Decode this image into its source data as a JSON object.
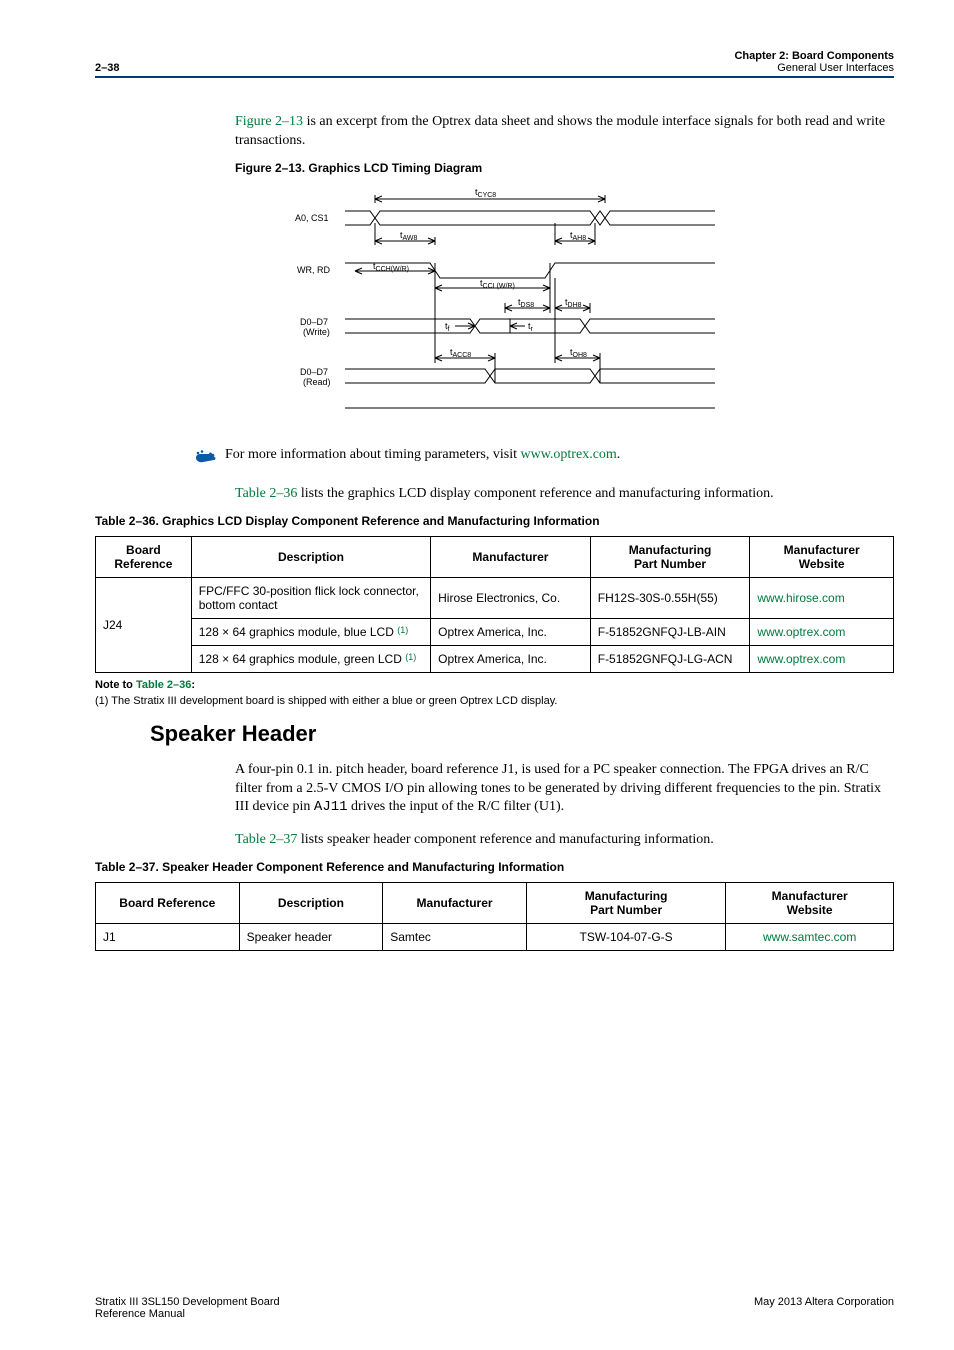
{
  "header": {
    "page_number": "2–38",
    "chapter_line": "Chapter 2: Board Components",
    "sub_line": "General User Interfaces"
  },
  "para_fig_intro_a": "Figure 2–13",
  "para_fig_intro_b": " is an excerpt from the Optrex data sheet and shows the module interface signals for both read and write transactions.",
  "figure": {
    "caption": "Figure 2–13.  Graphics LCD Timing Diagram",
    "signals": {
      "s1": "A0, CS1",
      "s2": "WR, RD",
      "s3a": "D0–D7",
      "s3b": "(Write)",
      "s4a": "D0–D7",
      "s4b": "(Read)"
    },
    "timing_labels": {
      "t_cyc8_pre": "t",
      "t_cyc8": "CYC8",
      "t_aw8_pre": "t",
      "t_aw8": "AW8",
      "t_ah8_pre": "t",
      "t_ah8": "AH8",
      "t_cchwr_pre": "t",
      "t_cchwr": "CCH(W/R)",
      "t_cclwr_pre": "t",
      "t_cclwr": "CCL(W/R)",
      "t_ds8_pre": "t",
      "t_ds8": "DS8",
      "t_dh8_pre": "t",
      "t_dh8": "DH8",
      "tf_pre": "t",
      "tf": "f",
      "tr_pre": "t",
      "tr": "r",
      "t_acc8_pre": "t",
      "t_acc8": "ACC8",
      "t_oh8_pre": "t",
      "t_oh8": "OH8"
    }
  },
  "hand_para_a": "For more information about timing parameters, visit ",
  "hand_para_link": "www.optrex.com",
  "hand_para_b": ".",
  "para_tbl36_a": "Table 2–36",
  "para_tbl36_b": " lists the graphics LCD display component reference and manufacturing information.",
  "table36": {
    "caption": "Table 2–36.  Graphics LCD Display Component Reference and Manufacturing Information",
    "headers": {
      "h1a": "Board",
      "h1b": "Reference",
      "h2": "Description",
      "h3": "Manufacturer",
      "h4a": "Manufacturing",
      "h4b": "Part Number",
      "h5a": "Manufacturer",
      "h5b": "Website"
    },
    "board_ref": "J24",
    "rows": [
      {
        "desc": "FPC/FFC 30-position flick lock connector, bottom contact",
        "note": "",
        "mfr": "Hirose Electronics, Co.",
        "part": "FH12S-30S-0.55H(55)",
        "site": "www.hirose.com"
      },
      {
        "desc": "128 × 64 graphics module, blue LCD ",
        "note": "(1)",
        "mfr": "Optrex America, Inc.",
        "part": "F-51852GNFQJ-LB-AIN",
        "site": "www.optrex.com"
      },
      {
        "desc": "128 × 64 graphics module, green LCD ",
        "note": "(1)",
        "mfr": "Optrex America, Inc.",
        "part": "F-51852GNFQJ-LG-ACN",
        "site": "www.optrex.com"
      }
    ],
    "note_bold": "Note to ",
    "note_link": "Table 2–36",
    "note_colon": ":",
    "note_body": "(1)   The Stratix III development board is shipped with either a blue or green Optrex LCD display."
  },
  "section_speaker": {
    "title": "Speaker Header",
    "para1a": "A four-pin 0.1 in. pitch header, board reference J1, is used for a PC speaker connection. The FPGA drives an R/C filter from a 2.5-V CMOS I/O pin allowing tones to be generated by driving different frequencies to the pin. Stratix III device pin ",
    "para1_mono": "AJ11",
    "para1b": " drives the input of the R/C filter (U1).",
    "para2a": "Table 2–37",
    "para2b": " lists speaker header component reference and manufacturing information."
  },
  "table37": {
    "caption": "Table 2–37.  Speaker Header Component Reference and Manufacturing Information",
    "headers": {
      "h1": "Board Reference",
      "h2": "Description",
      "h3": "Manufacturer",
      "h4a": "Manufacturing",
      "h4b": "Part Number",
      "h5a": "Manufacturer",
      "h5b": "Website"
    },
    "row": {
      "ref": "J1",
      "desc": "Speaker header",
      "mfr": "Samtec",
      "part": "TSW-104-07-G-S",
      "site": "www.samtec.com"
    }
  },
  "footer": {
    "left1": "Stratix III 3SL150 Development Board",
    "left2": "Reference Manual",
    "right": "May 2013   Altera Corporation"
  }
}
